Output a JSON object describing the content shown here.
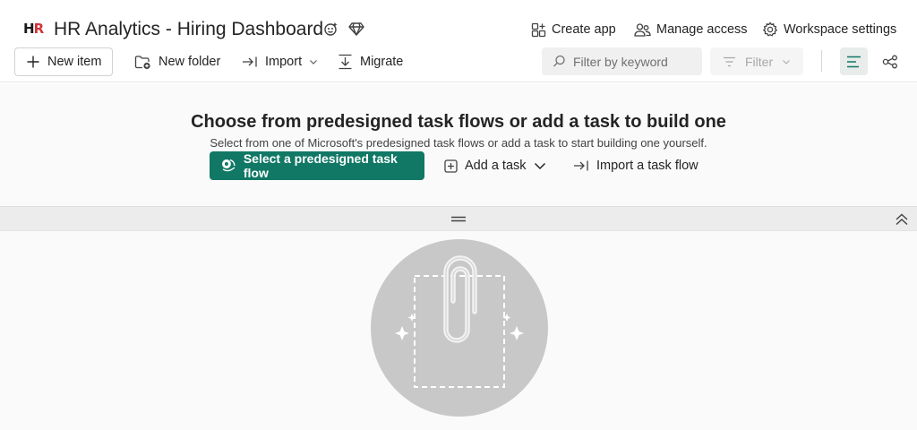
{
  "header": {
    "title": "HR Analytics - Hiring Dashboard",
    "actions": {
      "create_app": "Create app",
      "manage_access": "Manage access",
      "workspace_settings": "Workspace settings"
    }
  },
  "toolbar": {
    "new_item": "New item",
    "new_folder": "New folder",
    "import": "Import",
    "migrate": "Migrate",
    "search_placeholder": "Filter by keyword",
    "filter": "Filter"
  },
  "task_flow": {
    "title": "Choose from predesigned task flows or add a task to build one",
    "subtitle": "Select from one of Microsoft's predesigned task flows or add a task to start building one yourself.",
    "primary_button": "Select a predesigned task flow",
    "add_task": "Add a task",
    "import_task_flow": "Import a task flow"
  },
  "colors": {
    "primary": "#117865",
    "logo_red": "#d13438",
    "illustration_gray": "#c8c8c8"
  }
}
